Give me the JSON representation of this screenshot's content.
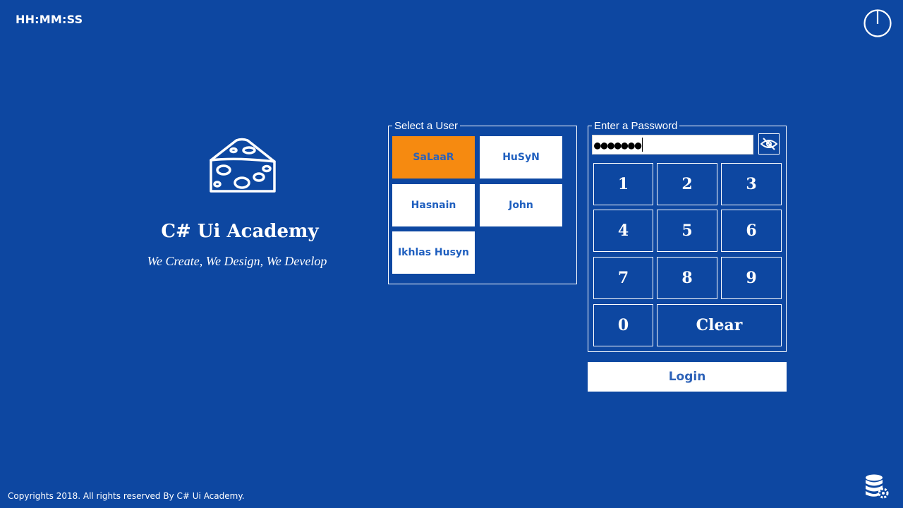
{
  "header": {
    "clock": "HH:MM:SS",
    "power_icon": "power-icon"
  },
  "brand": {
    "logo_icon": "cheese-icon",
    "title": "C# Ui Academy",
    "slogan": "We Create, We Design, We Develop"
  },
  "users_panel": {
    "legend": "Select a User",
    "users": [
      {
        "name": "SaLaaR",
        "selected": true
      },
      {
        "name": "HuSyN",
        "selected": false
      },
      {
        "name": "Hasnain",
        "selected": false
      },
      {
        "name": "John",
        "selected": false
      },
      {
        "name": "Ikhlas Husyn",
        "selected": false
      }
    ]
  },
  "password_panel": {
    "legend": "Enter a Password",
    "value": "●●●●●●●",
    "reveal_icon": "eye-slash-icon",
    "keys": [
      "1",
      "2",
      "3",
      "4",
      "5",
      "6",
      "7",
      "8",
      "9",
      "0"
    ],
    "clear_label": "Clear"
  },
  "login_label": "Login",
  "footer": {
    "copyright": "Copyrights 2018. All rights reserved By C# Ui Academy.",
    "settings_icon": "database-settings-icon"
  },
  "colors": {
    "background": "#0d47a1",
    "accent": "#f68a10",
    "button_text": "#2d62b8"
  }
}
